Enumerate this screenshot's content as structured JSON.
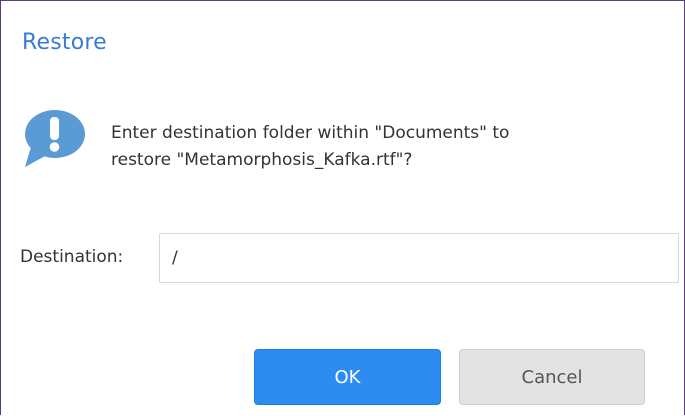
{
  "dialog": {
    "title": "Restore",
    "message_line1": "Enter destination folder within \"Documents\" to",
    "message_line2": "restore \"Metamorphosis_Kafka.rtf\"?",
    "destination_label": "Destination:",
    "destination_value": "/",
    "ok_label": "OK",
    "cancel_label": "Cancel"
  },
  "icons": {
    "message": "speech-bubble-exclamation-icon"
  },
  "colors": {
    "title": "#3a7bd5",
    "icon": "#5b9bd5",
    "ok_button": "#2d8cf0",
    "cancel_button": "#e3e3e3",
    "border": "#5a3d7a"
  }
}
